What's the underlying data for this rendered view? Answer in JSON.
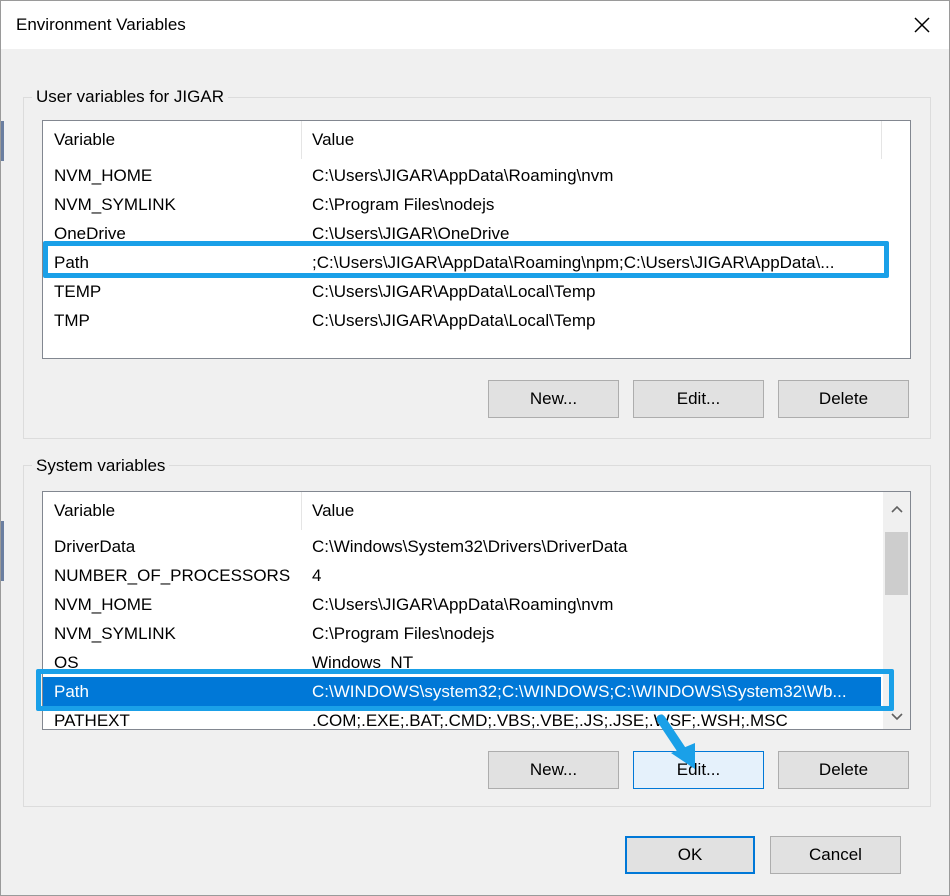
{
  "window": {
    "title": "Environment Variables"
  },
  "user_group": {
    "label": "User variables for JIGAR",
    "columns": [
      "Variable",
      "Value"
    ],
    "rows": [
      {
        "variable": "NVM_HOME",
        "value": "C:\\Users\\JIGAR\\AppData\\Roaming\\nvm"
      },
      {
        "variable": "NVM_SYMLINK",
        "value": "C:\\Program Files\\nodejs"
      },
      {
        "variable": "OneDrive",
        "value": "C:\\Users\\JIGAR\\OneDrive"
      },
      {
        "variable": "Path",
        "value": ";C:\\Users\\JIGAR\\AppData\\Roaming\\npm;C:\\Users\\JIGAR\\AppData\\..."
      },
      {
        "variable": "TEMP",
        "value": "C:\\Users\\JIGAR\\AppData\\Local\\Temp"
      },
      {
        "variable": "TMP",
        "value": "C:\\Users\\JIGAR\\AppData\\Local\\Temp"
      }
    ],
    "buttons": {
      "new": "New...",
      "edit": "Edit...",
      "delete": "Delete"
    }
  },
  "system_group": {
    "label": "System variables",
    "columns": [
      "Variable",
      "Value"
    ],
    "rows": [
      {
        "variable": "DriverData",
        "value": "C:\\Windows\\System32\\Drivers\\DriverData"
      },
      {
        "variable": "NUMBER_OF_PROCESSORS",
        "value": "4"
      },
      {
        "variable": "NVM_HOME",
        "value": "C:\\Users\\JIGAR\\AppData\\Roaming\\nvm"
      },
      {
        "variable": "NVM_SYMLINK",
        "value": "C:\\Program Files\\nodejs"
      },
      {
        "variable": "OS",
        "value": "Windows_NT"
      },
      {
        "variable": "Path",
        "value": "C:\\WINDOWS\\system32;C:\\WINDOWS;C:\\WINDOWS\\System32\\Wb..."
      },
      {
        "variable": "PATHEXT",
        "value": ".COM;.EXE;.BAT;.CMD;.VBS;.VBE;.JS;.JSE;.WSF;.WSH;.MSC"
      }
    ],
    "buttons": {
      "new": "New...",
      "edit": "Edit...",
      "delete": "Delete"
    }
  },
  "footer": {
    "ok": "OK",
    "cancel": "Cancel"
  },
  "colors": {
    "selection": "#0078d7",
    "annotation": "#1aa0e8"
  },
  "icons": {
    "close": "close-icon",
    "scroll_up": "chevron-up-icon",
    "scroll_down": "chevron-down-icon",
    "annotation": "arrow-annotation-icon"
  }
}
